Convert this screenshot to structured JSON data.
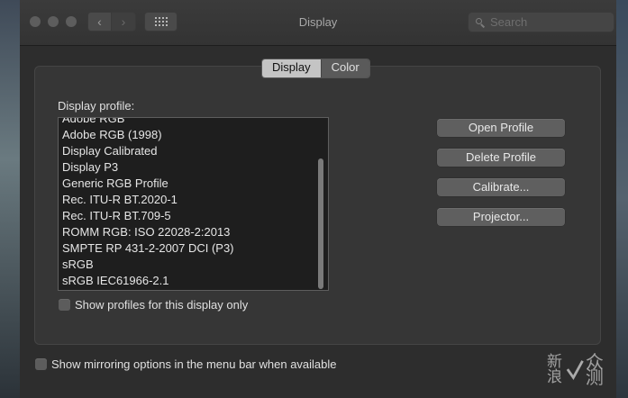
{
  "window": {
    "title": "Display",
    "search": {
      "placeholder": "Search",
      "value": ""
    }
  },
  "tabs": [
    {
      "label": "Display",
      "active": true
    },
    {
      "label": "Color",
      "active": false
    }
  ],
  "color_panel": {
    "profile_label": "Display profile:",
    "profiles": [
      "Adobe RGB",
      "Adobe RGB (1998)",
      "Display Calibrated",
      "Display P3",
      "Generic RGB Profile",
      "Rec. ITU-R BT.2020-1",
      "Rec. ITU-R BT.709-5",
      "ROMM RGB: ISO 22028-2:2013",
      "SMPTE RP 431-2-2007 DCI (P3)",
      "sRGB",
      "sRGB IEC61966-2.1"
    ],
    "buttons": {
      "open": "Open Profile",
      "delete": "Delete Profile",
      "calibrate": "Calibrate...",
      "projector": "Projector..."
    },
    "show_profiles_checkbox": {
      "label": "Show profiles for this display only",
      "checked": false
    }
  },
  "mirroring_checkbox": {
    "label": "Show mirroring options in the menu bar when available",
    "checked": false
  },
  "watermark": "新浪众测"
}
